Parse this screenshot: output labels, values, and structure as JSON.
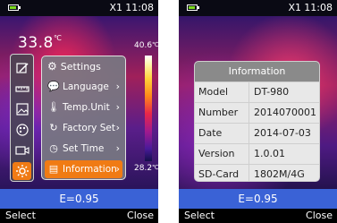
{
  "left_screen": {
    "status": {
      "mode": "X1",
      "time": "11:08"
    },
    "center_temp": "33.8",
    "temp_unit": "℃",
    "scale": {
      "max": "40.6",
      "min": "28.2",
      "unit": "℃"
    },
    "toolbar": [
      {
        "icon": "image-edit-icon"
      },
      {
        "icon": "ruler-icon"
      },
      {
        "icon": "gallery-icon"
      },
      {
        "icon": "palette-icon"
      },
      {
        "icon": "camera-icon"
      },
      {
        "icon": "gear-icon",
        "active": true
      }
    ],
    "settings_menu": {
      "title": "Settings",
      "items": [
        {
          "label": "Language",
          "icon": "speech-bubble-icon"
        },
        {
          "label": "Temp.Unit",
          "icon": "thermometer-icon"
        },
        {
          "label": "Factory Set",
          "icon": "reset-icon"
        },
        {
          "label": "Set Time",
          "icon": "clock-icon"
        },
        {
          "label": "Information",
          "icon": "document-icon",
          "active": true
        }
      ]
    },
    "emissivity": "E=0.95",
    "softkeys": {
      "left": "Select",
      "right": "Close"
    }
  },
  "right_screen": {
    "status": {
      "mode": "X1",
      "time": "11:08"
    },
    "info_panel": {
      "title": "Information",
      "rows": [
        {
          "label": "Model",
          "value": "DT-980"
        },
        {
          "label": "Number",
          "value": "2014070001"
        },
        {
          "label": "Date",
          "value": "2014-07-03"
        },
        {
          "label": "Version",
          "value": "1.0.01"
        },
        {
          "label": "SD-Card",
          "value": "1802M/4G"
        }
      ]
    },
    "emissivity": "E=0.95",
    "softkeys": {
      "left": "Select",
      "right": "Close"
    }
  },
  "colors": {
    "accent": "#f07b14",
    "bottom_strip": "#3a62d6",
    "battery": "#7ddc1f"
  }
}
